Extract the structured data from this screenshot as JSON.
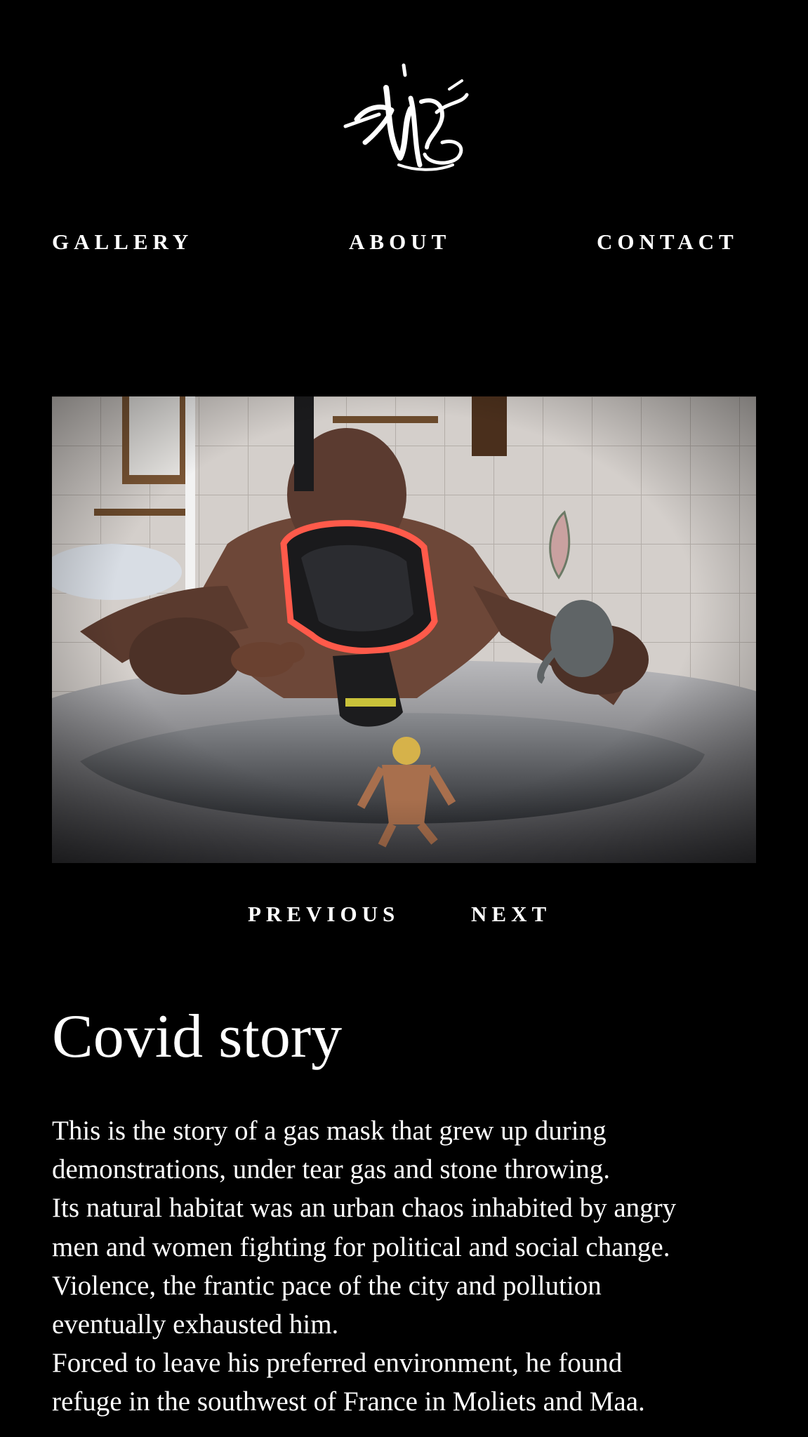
{
  "header": {
    "logo_icon": "graffiti-signature-logo-icon"
  },
  "nav": {
    "gallery": "GALLERY",
    "about": "ABOUT",
    "contact": "CONTACT"
  },
  "photo": {
    "subject": "gas-mask-bathtub-photo"
  },
  "pager": {
    "previous": "PREVIOUS",
    "next": "NEXT"
  },
  "article": {
    "title": "Covid story",
    "lines": [
      "This is the story of a gas mask that grew up during",
      "demonstrations, under tear gas and stone throwing.",
      "Its natural habitat was an urban chaos inhabited by angry",
      "men and women fighting for political and social change.",
      "Violence, the frantic pace of the city and pollution",
      "eventually exhausted him.",
      "Forced to leave his preferred environment, he found",
      "refuge in the southwest of France in Moliets and Maa."
    ]
  },
  "colors": {
    "background": "#000000",
    "text": "#ffffff",
    "mask_accent": "#ff5a4a"
  }
}
